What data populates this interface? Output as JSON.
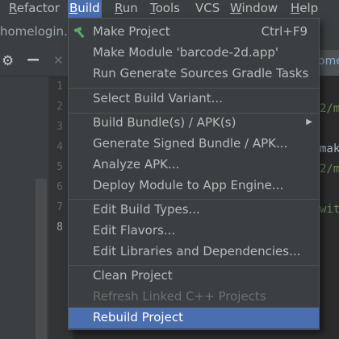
{
  "menubar": {
    "items": [
      {
        "mnemonic": "R",
        "rest": "efactor"
      },
      {
        "mnemonic": "B",
        "rest": "uild"
      },
      {
        "mnemonic": "R",
        "rest": "un"
      },
      {
        "mnemonic": "T",
        "rest": "ools"
      },
      {
        "mnemonic": "",
        "rest": "VCS"
      },
      {
        "mnemonic": "W",
        "rest": "indow"
      },
      {
        "mnemonic": "H",
        "rest": "elp"
      }
    ],
    "active": "Build"
  },
  "breadcrumb": {
    "text": "homelogin."
  },
  "editor": {
    "tab_fragment": "ome",
    "line_numbers": [
      "1",
      "2",
      "3",
      "4",
      "5",
      "6",
      "7",
      "8"
    ],
    "current_line": "8",
    "code_fragments": [
      "2/m",
      "mak",
      "2/m",
      "wit"
    ]
  },
  "build_menu": {
    "items": [
      {
        "label": "Make Project",
        "shortcut": "Ctrl+F9",
        "icon": "hammer-icon"
      },
      {
        "label": "Make Module 'barcode-2d.app'"
      },
      {
        "label": "Run Generate Sources Gradle Tasks"
      },
      {
        "label": "Select Build Variant..."
      },
      {
        "label": "Build Bundle(s) / APK(s)",
        "submenu": true
      },
      {
        "label": "Generate Signed Bundle / APK..."
      },
      {
        "label": "Analyze APK..."
      },
      {
        "label": "Deploy Module to App Engine..."
      },
      {
        "label": "Edit Build Types..."
      },
      {
        "label": "Edit Flavors..."
      },
      {
        "label": "Edit Libraries and Dependencies..."
      },
      {
        "label": "Clean Project"
      },
      {
        "label": "Refresh Linked C++ Projects",
        "disabled": true
      },
      {
        "label": "Rebuild Project",
        "selected": true
      }
    ]
  },
  "colors": {
    "menu_bg": "#3c3f41",
    "highlight": "#4b6eaf",
    "editor_bg": "#2b2b2b",
    "disabled_text": "#6e6e6e"
  }
}
